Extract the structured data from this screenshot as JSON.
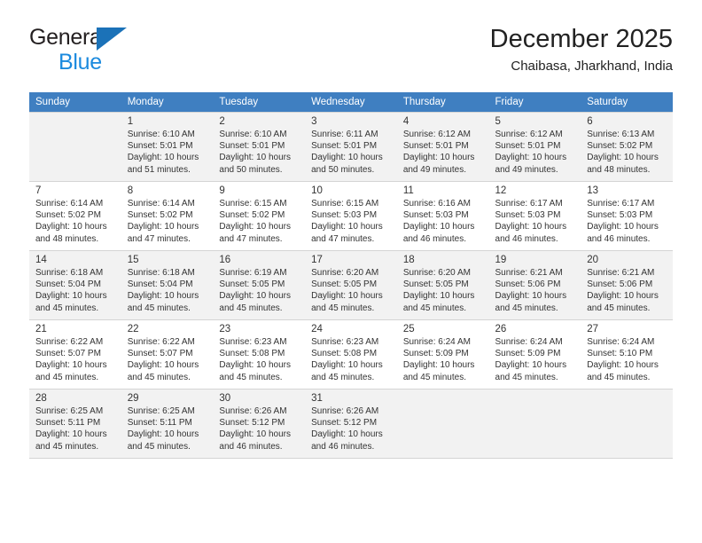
{
  "brand": {
    "word_one": "General",
    "word_two": "Blue",
    "triangle_icon": "blue-triangle-logo-mark",
    "colors": {
      "dark": "#231f20",
      "blue": "#1b8ade",
      "triangle": "#1b72b8"
    }
  },
  "header": {
    "title": "December 2025",
    "subtitle": "Chaibasa, Jharkhand, India"
  },
  "calendar": {
    "accent_header_color": "#3f7fc1",
    "shaded_row_color": "#f2f2f2",
    "weekdays": [
      "Sunday",
      "Monday",
      "Tuesday",
      "Wednesday",
      "Thursday",
      "Friday",
      "Saturday"
    ],
    "weeks": [
      {
        "shaded": true,
        "days": [
          {
            "num": "",
            "detail": ""
          },
          {
            "num": "1",
            "detail": "Sunrise: 6:10 AM\nSunset: 5:01 PM\nDaylight: 10 hours\nand 51 minutes."
          },
          {
            "num": "2",
            "detail": "Sunrise: 6:10 AM\nSunset: 5:01 PM\nDaylight: 10 hours\nand 50 minutes."
          },
          {
            "num": "3",
            "detail": "Sunrise: 6:11 AM\nSunset: 5:01 PM\nDaylight: 10 hours\nand 50 minutes."
          },
          {
            "num": "4",
            "detail": "Sunrise: 6:12 AM\nSunset: 5:01 PM\nDaylight: 10 hours\nand 49 minutes."
          },
          {
            "num": "5",
            "detail": "Sunrise: 6:12 AM\nSunset: 5:01 PM\nDaylight: 10 hours\nand 49 minutes."
          },
          {
            "num": "6",
            "detail": "Sunrise: 6:13 AM\nSunset: 5:02 PM\nDaylight: 10 hours\nand 48 minutes."
          }
        ]
      },
      {
        "shaded": false,
        "days": [
          {
            "num": "7",
            "detail": "Sunrise: 6:14 AM\nSunset: 5:02 PM\nDaylight: 10 hours\nand 48 minutes."
          },
          {
            "num": "8",
            "detail": "Sunrise: 6:14 AM\nSunset: 5:02 PM\nDaylight: 10 hours\nand 47 minutes."
          },
          {
            "num": "9",
            "detail": "Sunrise: 6:15 AM\nSunset: 5:02 PM\nDaylight: 10 hours\nand 47 minutes."
          },
          {
            "num": "10",
            "detail": "Sunrise: 6:15 AM\nSunset: 5:03 PM\nDaylight: 10 hours\nand 47 minutes."
          },
          {
            "num": "11",
            "detail": "Sunrise: 6:16 AM\nSunset: 5:03 PM\nDaylight: 10 hours\nand 46 minutes."
          },
          {
            "num": "12",
            "detail": "Sunrise: 6:17 AM\nSunset: 5:03 PM\nDaylight: 10 hours\nand 46 minutes."
          },
          {
            "num": "13",
            "detail": "Sunrise: 6:17 AM\nSunset: 5:03 PM\nDaylight: 10 hours\nand 46 minutes."
          }
        ]
      },
      {
        "shaded": true,
        "days": [
          {
            "num": "14",
            "detail": "Sunrise: 6:18 AM\nSunset: 5:04 PM\nDaylight: 10 hours\nand 45 minutes."
          },
          {
            "num": "15",
            "detail": "Sunrise: 6:18 AM\nSunset: 5:04 PM\nDaylight: 10 hours\nand 45 minutes."
          },
          {
            "num": "16",
            "detail": "Sunrise: 6:19 AM\nSunset: 5:05 PM\nDaylight: 10 hours\nand 45 minutes."
          },
          {
            "num": "17",
            "detail": "Sunrise: 6:20 AM\nSunset: 5:05 PM\nDaylight: 10 hours\nand 45 minutes."
          },
          {
            "num": "18",
            "detail": "Sunrise: 6:20 AM\nSunset: 5:05 PM\nDaylight: 10 hours\nand 45 minutes."
          },
          {
            "num": "19",
            "detail": "Sunrise: 6:21 AM\nSunset: 5:06 PM\nDaylight: 10 hours\nand 45 minutes."
          },
          {
            "num": "20",
            "detail": "Sunrise: 6:21 AM\nSunset: 5:06 PM\nDaylight: 10 hours\nand 45 minutes."
          }
        ]
      },
      {
        "shaded": false,
        "days": [
          {
            "num": "21",
            "detail": "Sunrise: 6:22 AM\nSunset: 5:07 PM\nDaylight: 10 hours\nand 45 minutes."
          },
          {
            "num": "22",
            "detail": "Sunrise: 6:22 AM\nSunset: 5:07 PM\nDaylight: 10 hours\nand 45 minutes."
          },
          {
            "num": "23",
            "detail": "Sunrise: 6:23 AM\nSunset: 5:08 PM\nDaylight: 10 hours\nand 45 minutes."
          },
          {
            "num": "24",
            "detail": "Sunrise: 6:23 AM\nSunset: 5:08 PM\nDaylight: 10 hours\nand 45 minutes."
          },
          {
            "num": "25",
            "detail": "Sunrise: 6:24 AM\nSunset: 5:09 PM\nDaylight: 10 hours\nand 45 minutes."
          },
          {
            "num": "26",
            "detail": "Sunrise: 6:24 AM\nSunset: 5:09 PM\nDaylight: 10 hours\nand 45 minutes."
          },
          {
            "num": "27",
            "detail": "Sunrise: 6:24 AM\nSunset: 5:10 PM\nDaylight: 10 hours\nand 45 minutes."
          }
        ]
      },
      {
        "shaded": true,
        "days": [
          {
            "num": "28",
            "detail": "Sunrise: 6:25 AM\nSunset: 5:11 PM\nDaylight: 10 hours\nand 45 minutes."
          },
          {
            "num": "29",
            "detail": "Sunrise: 6:25 AM\nSunset: 5:11 PM\nDaylight: 10 hours\nand 45 minutes."
          },
          {
            "num": "30",
            "detail": "Sunrise: 6:26 AM\nSunset: 5:12 PM\nDaylight: 10 hours\nand 46 minutes."
          },
          {
            "num": "31",
            "detail": "Sunrise: 6:26 AM\nSunset: 5:12 PM\nDaylight: 10 hours\nand 46 minutes."
          },
          {
            "num": "",
            "detail": ""
          },
          {
            "num": "",
            "detail": ""
          },
          {
            "num": "",
            "detail": ""
          }
        ]
      }
    ]
  }
}
